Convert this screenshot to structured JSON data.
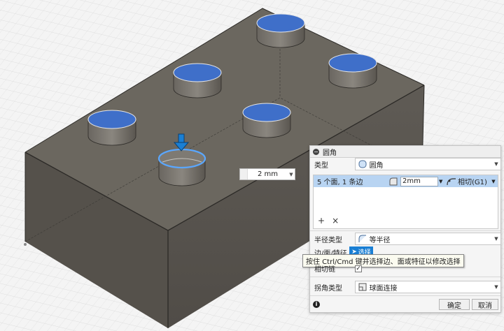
{
  "viewport": {
    "description_label": ""
  },
  "inline_stepper": {
    "value": "2 mm"
  },
  "dialog": {
    "title": "圆角",
    "type_label": "类型",
    "type_value": "圆角",
    "selection": {
      "count": "5 个面, 1 条边",
      "radius": "2mm",
      "continuity": "相切(G1)"
    },
    "add_symbol": "+",
    "remove_symbol": "×",
    "radius_type_label": "半径类型",
    "radius_type_value": "等半径",
    "edges_label": "边/面/特征",
    "select_button": "选择",
    "tooltip": "按住 Ctrl/Cmd 键并选择边、面或特征以修改选择",
    "tangent_chain_label": "相切链",
    "tangent_chain_checked": "✓",
    "corner_type_label": "拐角类型",
    "corner_type_value": "球面连接",
    "ok": "确定",
    "cancel": "取消",
    "info": "i"
  },
  "colors": {
    "accent": "#1a7fd4",
    "selected_face": "#3f6fc9",
    "body": "#5a5650"
  }
}
